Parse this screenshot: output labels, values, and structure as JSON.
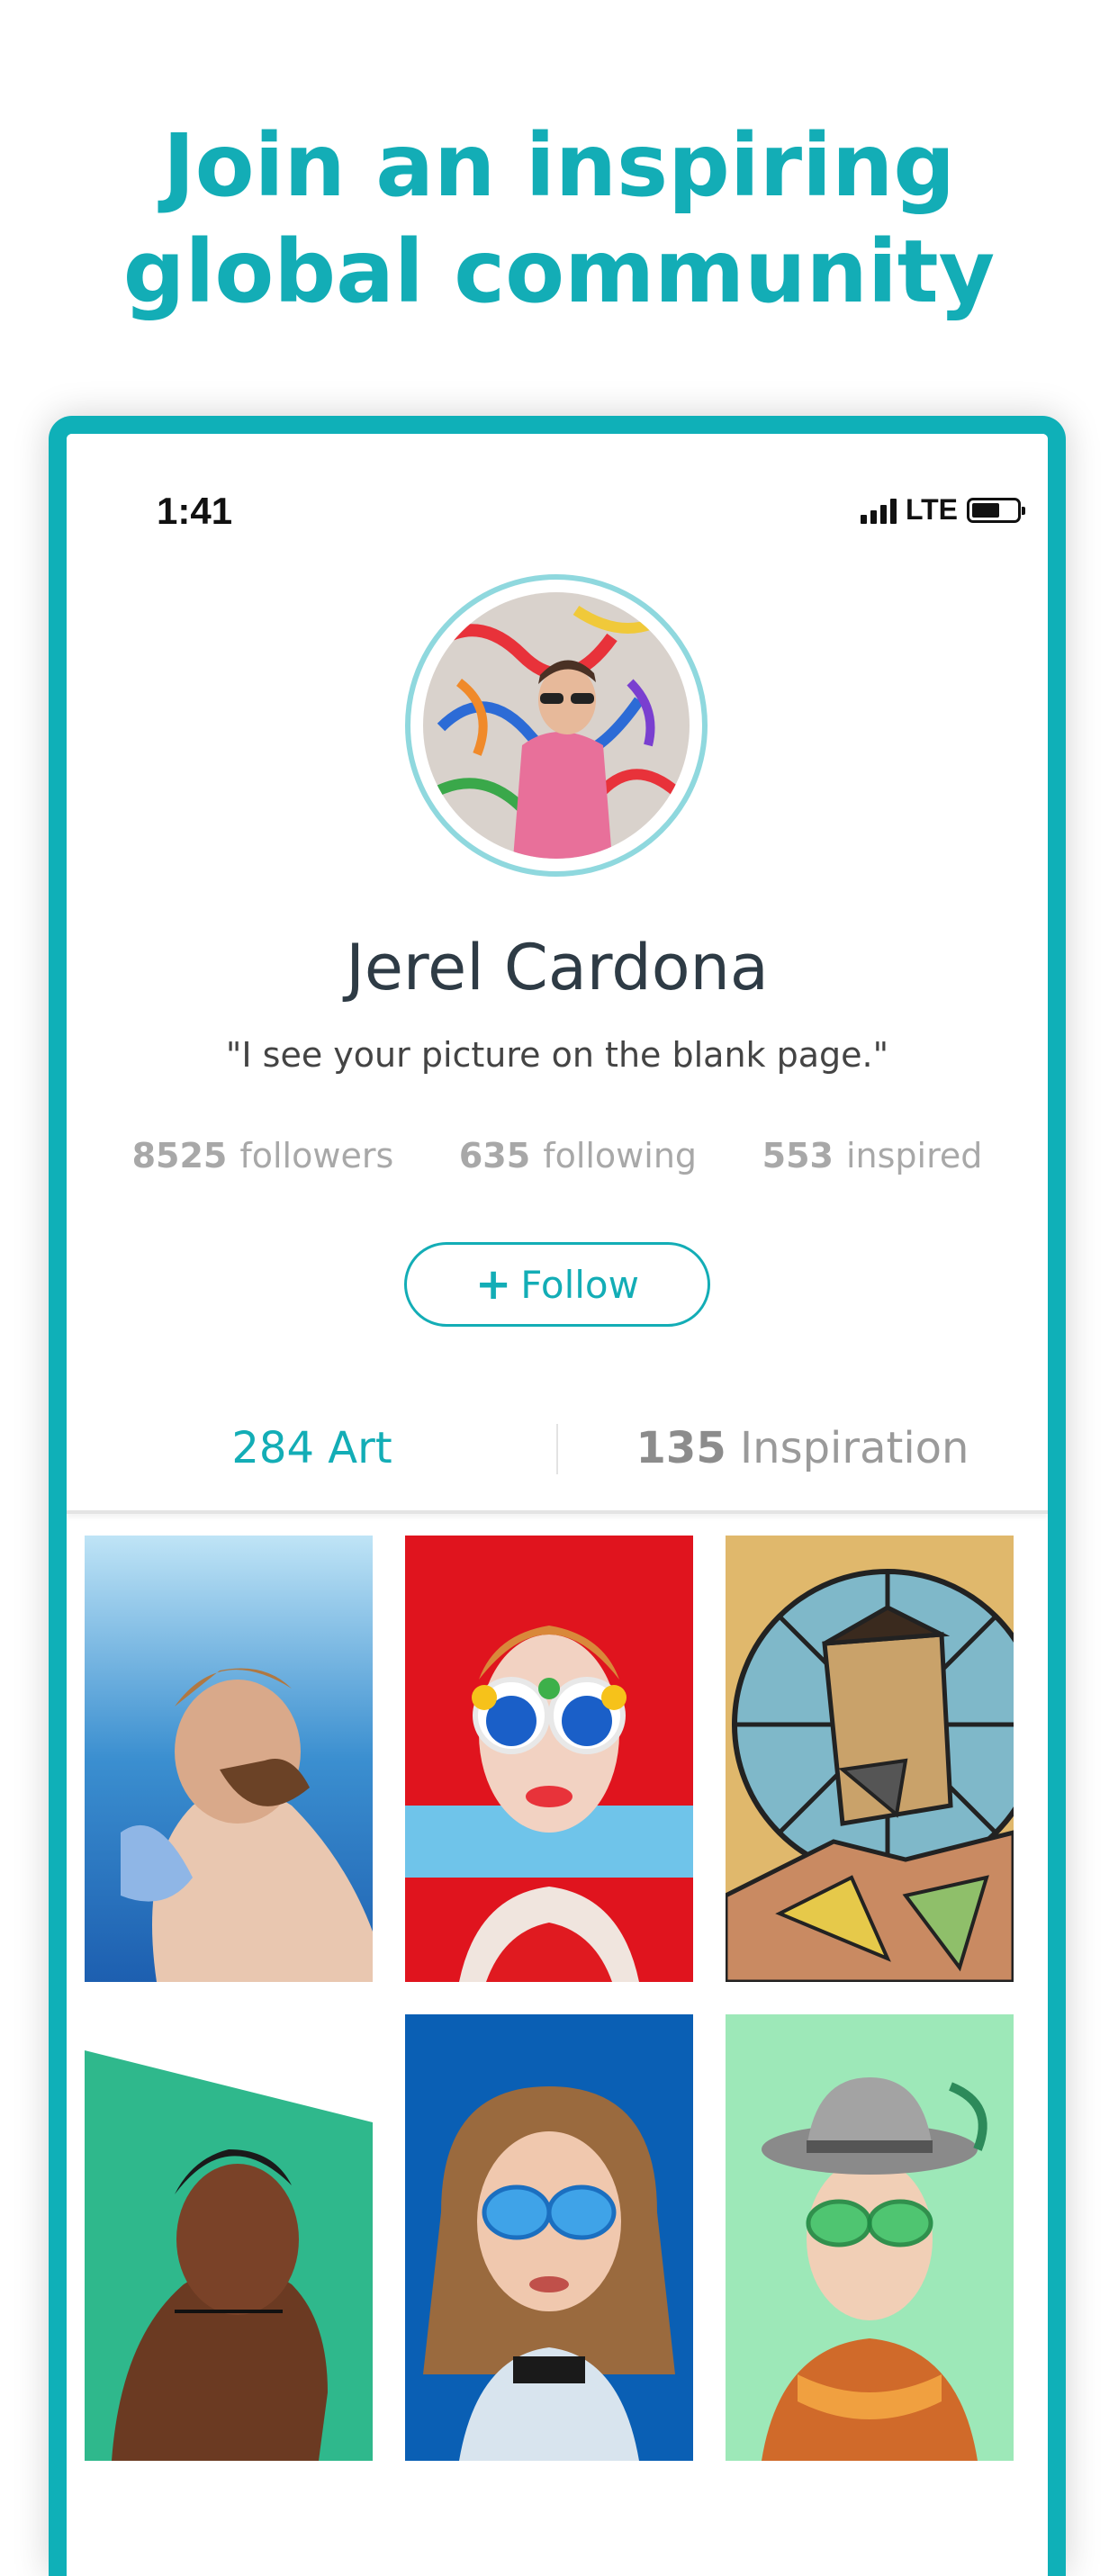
{
  "headline": {
    "line1": "Join an inspiring",
    "line2": "global community"
  },
  "status_bar": {
    "time": "1:41",
    "network": "LTE"
  },
  "profile": {
    "name": "Jerel Cardona",
    "quote": "\"I see your picture on the blank page.\"",
    "stats": [
      {
        "count": "8525",
        "label": "followers"
      },
      {
        "count": "635",
        "label": "following"
      },
      {
        "count": "553",
        "label": "inspired"
      }
    ],
    "follow_label": "Follow"
  },
  "tabs": [
    {
      "count": "284",
      "label": "Art",
      "active": true
    },
    {
      "count": "135",
      "label": "Inspiration",
      "active": false
    }
  ],
  "artworks": [
    {
      "name": "artwork-bearded-man-blue"
    },
    {
      "name": "artwork-woman-red-hat-sunglasses"
    },
    {
      "name": "artwork-mosaic-man"
    },
    {
      "name": "artwork-man-green-background"
    },
    {
      "name": "artwork-woman-blue-sunglasses"
    },
    {
      "name": "artwork-man-grey-hat"
    }
  ],
  "colors": {
    "accent": "#13adb6",
    "frame": "#0fb0b8",
    "avatar_ring": "#8fd8de",
    "stat_text": "#a8a8a8"
  }
}
